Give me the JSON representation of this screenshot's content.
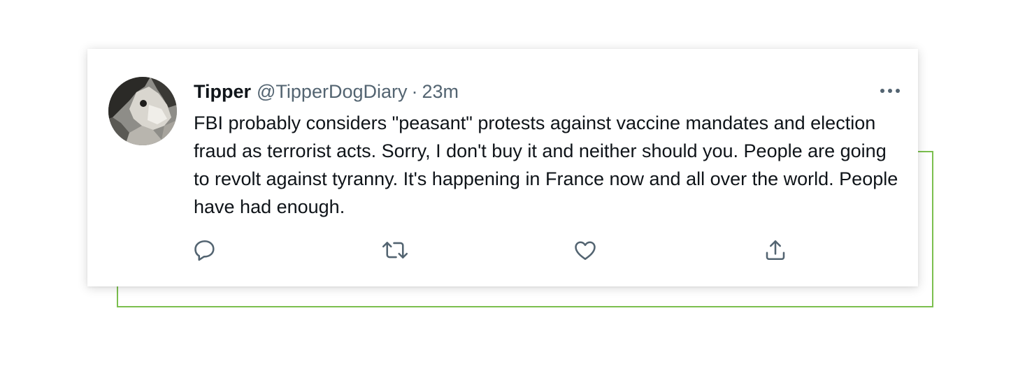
{
  "tweet": {
    "author": {
      "display_name": "Tipper",
      "handle": "@TipperDogDiary",
      "separator": "·",
      "timestamp": "23m"
    },
    "text": "FBI probably considers \"peasant\" protests against vaccine mandates and election fraud as terrorist acts. Sorry, I don't buy it and neither should you. People are going to revolt against tyranny. It's happening in France now and all over the world. People have had enough.",
    "actions": [
      {
        "icon": "reply-icon"
      },
      {
        "icon": "retweet-icon"
      },
      {
        "icon": "like-icon"
      },
      {
        "icon": "share-icon"
      }
    ],
    "more_icon": "more-options-icon"
  },
  "colors": {
    "text_primary": "#0f1419",
    "text_secondary": "#536471",
    "accent_frame": "#7bbf4e",
    "card_background": "#ffffff"
  }
}
